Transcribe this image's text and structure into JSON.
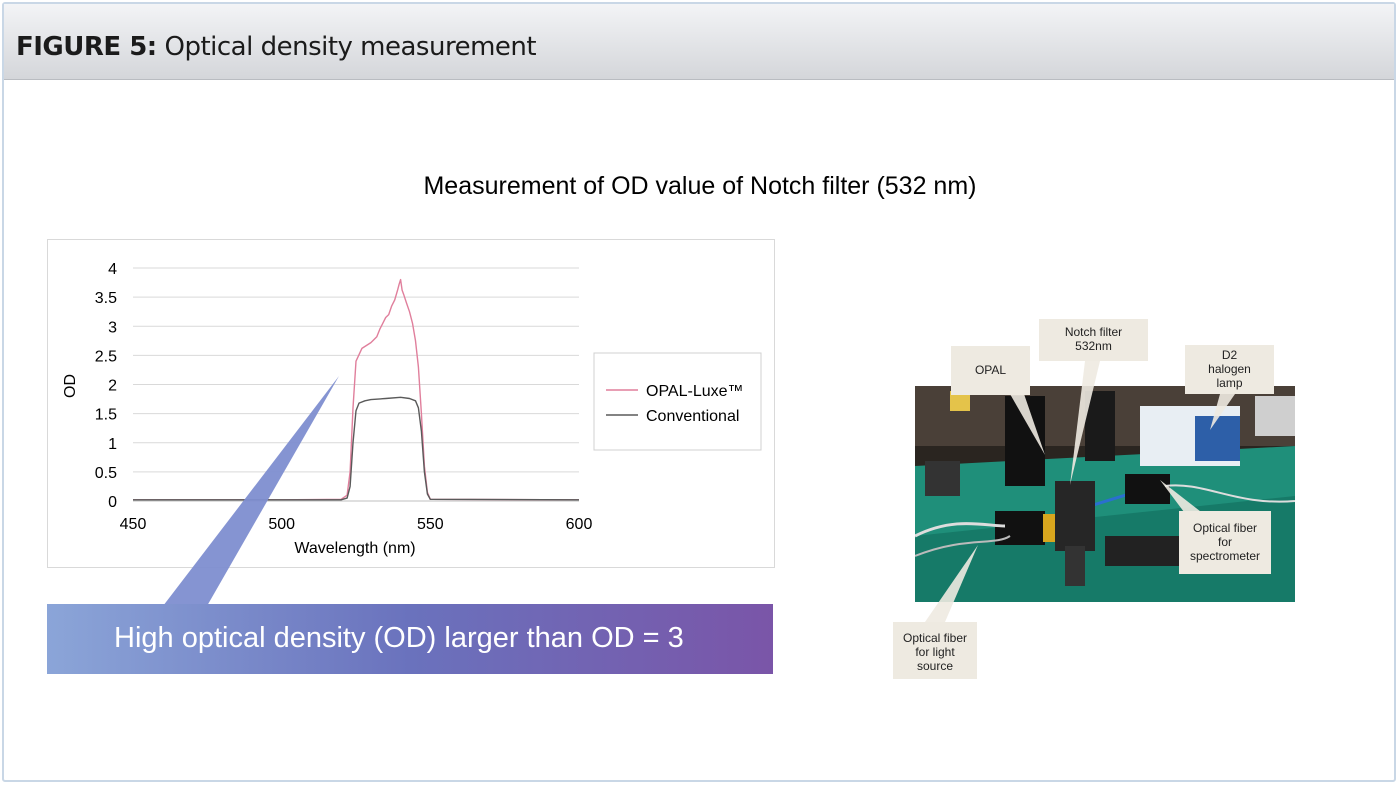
{
  "header": {
    "figure_label": "FIGURE 5:",
    "figure_caption": "Optical density measurement"
  },
  "slide_title": "Measurement of OD value of Notch filter (532 nm)",
  "callout": "High optical density (OD) larger than OD = 3",
  "photo_labels": {
    "opal": "OPAL",
    "notch": [
      "Notch filter",
      "532nm"
    ],
    "lamp": [
      "D2",
      "halogen",
      "lamp"
    ],
    "fiber_spectrometer": [
      "Optical fiber",
      "for",
      "spectrometer"
    ],
    "fiber_light": [
      "Optical fiber",
      "for light",
      "source"
    ]
  },
  "colors": {
    "opal_luxe": "#e07f9c",
    "conventional": "#5a5a5a",
    "callout_start": "#8ba5d8",
    "callout_end": "#7a55a8"
  },
  "chart_data": {
    "type": "line",
    "title": "",
    "xlabel": "Wavelength (nm)",
    "ylabel": "OD",
    "xlim": [
      450,
      600
    ],
    "ylim": [
      0,
      4
    ],
    "x_ticks": [
      450,
      500,
      550,
      600
    ],
    "y_ticks": [
      0,
      0.5,
      1,
      1.5,
      2,
      2.5,
      3,
      3.5,
      4
    ],
    "y_tick_labels": [
      "0",
      "0.5",
      "1",
      "1.5",
      "2",
      "2.5",
      "3",
      "3.5",
      "4"
    ],
    "grid": "horizontal",
    "legend_position": "right",
    "series": [
      {
        "name": "OPAL-Luxe™",
        "color": "#e07f9c",
        "points": [
          [
            450,
            0.02
          ],
          [
            500,
            0.02
          ],
          [
            520,
            0.03
          ],
          [
            522,
            0.1
          ],
          [
            523,
            0.5
          ],
          [
            524,
            1.6
          ],
          [
            525,
            2.4
          ],
          [
            527,
            2.62
          ],
          [
            530,
            2.72
          ],
          [
            532,
            2.82
          ],
          [
            533,
            2.95
          ],
          [
            534,
            3.05
          ],
          [
            535,
            3.15
          ],
          [
            536,
            3.2
          ],
          [
            537,
            3.35
          ],
          [
            538,
            3.45
          ],
          [
            539,
            3.62
          ],
          [
            539.5,
            3.72
          ],
          [
            540,
            3.8
          ],
          [
            540.5,
            3.62
          ],
          [
            541,
            3.55
          ],
          [
            542,
            3.4
          ],
          [
            543,
            3.25
          ],
          [
            544,
            3.05
          ],
          [
            545,
            2.75
          ],
          [
            546,
            2.3
          ],
          [
            547,
            1.5
          ],
          [
            548,
            0.6
          ],
          [
            549,
            0.15
          ],
          [
            550,
            0.03
          ],
          [
            600,
            0.02
          ]
        ]
      },
      {
        "name": "Conventional",
        "color": "#5a5a5a",
        "points": [
          [
            450,
            0.02
          ],
          [
            520,
            0.02
          ],
          [
            522,
            0.05
          ],
          [
            523,
            0.25
          ],
          [
            524,
            1.0
          ],
          [
            525,
            1.55
          ],
          [
            526,
            1.68
          ],
          [
            528,
            1.72
          ],
          [
            530,
            1.74
          ],
          [
            535,
            1.76
          ],
          [
            540,
            1.78
          ],
          [
            543,
            1.76
          ],
          [
            545,
            1.72
          ],
          [
            546,
            1.6
          ],
          [
            547,
            1.2
          ],
          [
            548,
            0.5
          ],
          [
            549,
            0.12
          ],
          [
            550,
            0.03
          ],
          [
            600,
            0.02
          ]
        ]
      }
    ]
  }
}
